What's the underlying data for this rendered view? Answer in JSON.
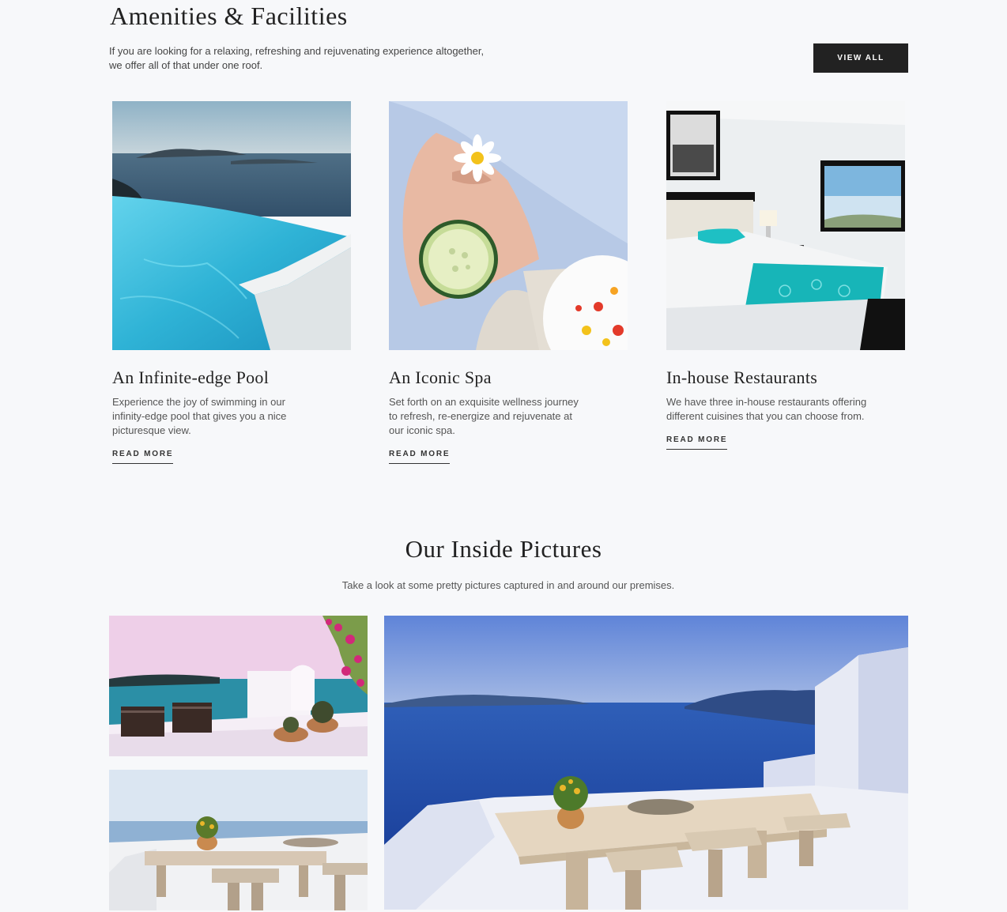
{
  "amenities": {
    "title": "Amenities & Facilities",
    "intro_line1": "If you are looking for a relaxing, refreshing and rejuvenating experience altogether,",
    "intro_line2": "we offer all of that under one roof.",
    "view_all_label": "VIEW ALL",
    "cards": [
      {
        "title": "An Infinite-edge Pool",
        "desc": "Experience the joy of swimming in our infinity-edge pool that gives you a nice picturesque view.",
        "link": "READ MORE"
      },
      {
        "title": "An Iconic Spa",
        "desc": "Set forth on an exquisite wellness journey to refresh, re-energize and rejuvenate at our iconic spa.",
        "link": "READ MORE"
      },
      {
        "title": "In-house Restaurants",
        "desc": "We have three in-house restaurants offering different cuisines that you can choose from.",
        "link": "READ MORE"
      }
    ]
  },
  "gallery": {
    "title": "Our Inside Pictures",
    "subtitle": "Take a look at some pretty pictures captured in and around our premises."
  },
  "colors": {
    "background": "#f7f8fa",
    "button": "#222222",
    "pool_water": "#2fb3d6",
    "accent_teal": "#17b5b8"
  }
}
